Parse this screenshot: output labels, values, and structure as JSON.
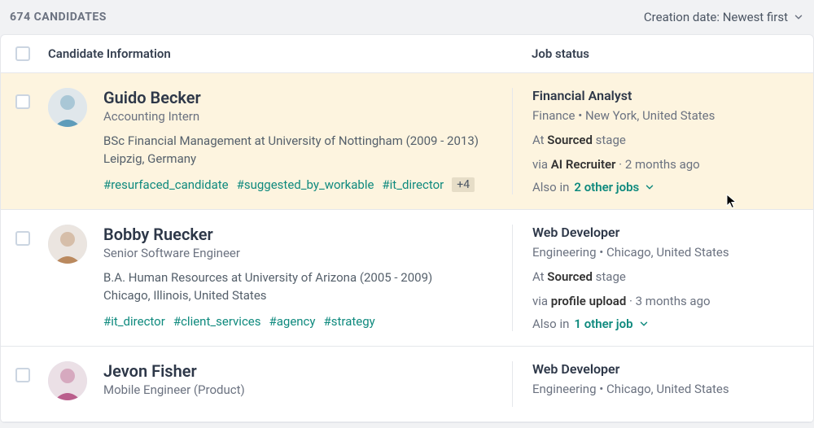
{
  "header": {
    "count_label": "674 CANDIDATES",
    "sort_label": "Creation date: Newest first"
  },
  "columns": {
    "info_label": "Candidate Information",
    "job_label": "Job status"
  },
  "strings": {
    "at": "At ",
    "stage_suffix": " stage",
    "via": "via ",
    "also_in": "Also in ",
    "time_sep": " · "
  },
  "rows": [
    {
      "highlight": true,
      "name": "Guido Becker",
      "role": "Accounting Intern",
      "education": "BSc Financial Management at University of Nottingham (2009 - 2013)",
      "location": "Leipzig, Germany",
      "tags": [
        "#resurfaced_candidate",
        "#suggested_by_workable",
        "#it_director"
      ],
      "extra_tags": "+4",
      "job": {
        "title": "Financial Analyst",
        "meta": "Finance  •  New York, United States",
        "stage": "Sourced",
        "via": "AI Recruiter",
        "via_time": "2 months ago",
        "other_jobs": "2 other jobs"
      },
      "avatar_hue": 200
    },
    {
      "highlight": false,
      "name": "Bobby Ruecker",
      "role": "Senior Software Engineer",
      "education": "B.A. Human Resources at University of Arizona (2005 - 2009)",
      "location": "Chicago, Illinois, United States",
      "tags": [
        "#it_director",
        "#client_services",
        "#agency",
        "#strategy"
      ],
      "extra_tags": "",
      "job": {
        "title": "Web Developer",
        "meta": "Engineering  •  Chicago, United States",
        "stage": "Sourced",
        "via": "profile upload",
        "via_time": "3 months ago",
        "other_jobs": "1 other job"
      },
      "avatar_hue": 28
    },
    {
      "highlight": false,
      "name": "Jevon Fisher",
      "role": "Mobile Engineer (Product)",
      "education": "",
      "location": "",
      "tags": [],
      "extra_tags": "",
      "job": {
        "title": "Web Developer",
        "meta": "Engineering  •  Chicago, United States",
        "stage": "",
        "via": "",
        "via_time": "",
        "other_jobs": ""
      },
      "avatar_hue": 330
    }
  ]
}
